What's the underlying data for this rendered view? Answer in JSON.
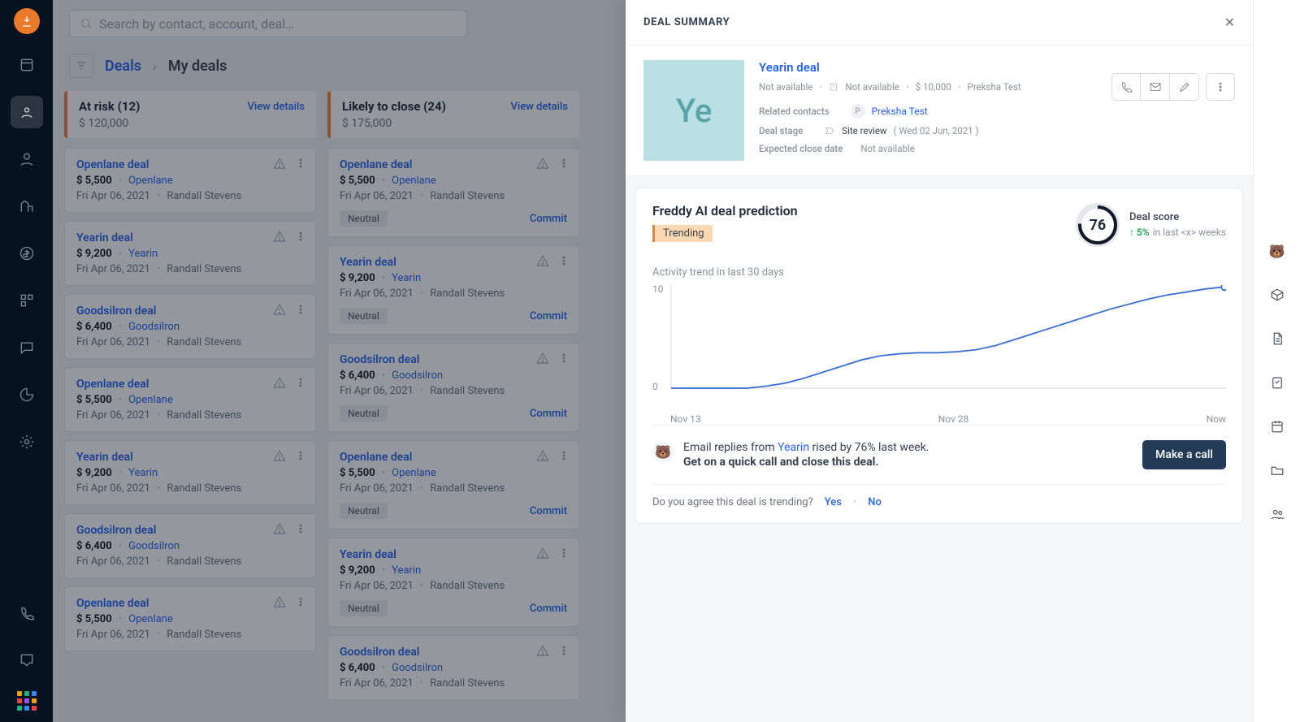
{
  "search": {
    "placeholder": "Search by contact, account, deal…"
  },
  "breadcrumb": {
    "root": "Deals",
    "current": "My deals"
  },
  "columns": [
    {
      "title": "At risk (12)",
      "amount": "$ 120,000",
      "view": "View details",
      "cards": [
        {
          "name": "Openlane deal",
          "amount": "$ 5,500",
          "account": "Openlane",
          "date": "Fri Apr 06, 2021",
          "owner": "Randall Stevens"
        },
        {
          "name": "Yearin deal",
          "amount": "$ 9,200",
          "account": "Yearin",
          "date": "Fri Apr 06, 2021",
          "owner": "Randall Stevens"
        },
        {
          "name": "Goodsilron deal",
          "amount": "$ 6,400",
          "account": "Goodsilron",
          "date": "Fri Apr 06, 2021",
          "owner": "Randall Stevens"
        },
        {
          "name": "Openlane deal",
          "amount": "$ 5,500",
          "account": "Openlane",
          "date": "Fri Apr 06, 2021",
          "owner": "Randall Stevens"
        },
        {
          "name": "Yearin deal",
          "amount": "$ 9,200",
          "account": "Yearin",
          "date": "Fri Apr 06, 2021",
          "owner": "Randall Stevens"
        },
        {
          "name": "Goodsilron deal",
          "amount": "$ 6,400",
          "account": "Goodsilron",
          "date": "Fri Apr 06, 2021",
          "owner": "Randall Stevens"
        },
        {
          "name": "Openlane deal",
          "amount": "$ 5,500",
          "account": "Openlane",
          "date": "Fri Apr 06, 2021",
          "owner": "Randall Stevens"
        }
      ]
    },
    {
      "title": "Likely to close (24)",
      "amount": "$ 175,000",
      "view": "View details",
      "cards": [
        {
          "name": "Openlane deal",
          "amount": "$ 5,500",
          "account": "Openlane",
          "date": "Fri Apr 06, 2021",
          "owner": "Randall Stevens",
          "tag": "Neutral",
          "commit": "Commit"
        },
        {
          "name": "Yearin deal",
          "amount": "$ 9,200",
          "account": "Yearin",
          "date": "Fri Apr 06, 2021",
          "owner": "Randall Stevens",
          "tag": "Neutral",
          "commit": "Commit"
        },
        {
          "name": "Goodsilron deal",
          "amount": "$ 6,400",
          "account": "Goodsilron",
          "date": "Fri Apr 06, 2021",
          "owner": "Randall Stevens",
          "tag": "Neutral",
          "commit": "Commit"
        },
        {
          "name": "Openlane deal",
          "amount": "$ 5,500",
          "account": "Openlane",
          "date": "Fri Apr 06, 2021",
          "owner": "Randall Stevens",
          "tag": "Neutral",
          "commit": "Commit"
        },
        {
          "name": "Yearin deal",
          "amount": "$ 9,200",
          "account": "Yearin",
          "date": "Fri Apr 06, 2021",
          "owner": "Randall Stevens",
          "tag": "Neutral",
          "commit": "Commit"
        },
        {
          "name": "Goodsilron deal",
          "amount": "$ 6,400",
          "account": "Goodsilron",
          "date": "Fri Apr 06, 2021",
          "owner": "Randall Stevens"
        }
      ]
    }
  ],
  "panel": {
    "heading": "DEAL SUMMARY",
    "deal_name": "Yearin deal",
    "thumb_initials": "Ye",
    "meta": {
      "phone": "Not available",
      "email": "Not available",
      "value": "$ 10,000",
      "owner": "Preksha Test"
    },
    "related_contacts_label": "Related contacts",
    "related_contact_initial": "P",
    "related_contact_name": "Preksha Test",
    "stage_label": "Deal stage",
    "stage_value": "Site review",
    "stage_date": "( Wed 02 Jun, 2021 )",
    "close_label": "Expected close date",
    "close_value": "Not available",
    "prediction": {
      "title": "Freddy AI deal prediction",
      "trend_tag": "Trending",
      "score_label": "Deal score",
      "score": "76",
      "delta": "5%",
      "delta_suffix": "in last <x> weeks",
      "chart_title": "Activity trend in last 30 days",
      "insight_prefix": "Email replies from ",
      "insight_link": "Yearin",
      "insight_suffix": " rised by 76% last week.",
      "insight_bold": "Get on a quick call and close this deal.",
      "cta": "Make a call",
      "agree_q": "Do you agree this deal is trending?",
      "agree_yes": "Yes",
      "agree_no": "No"
    }
  },
  "chart_data": {
    "type": "line",
    "title": "Activity trend in last 30 days",
    "ylim": [
      0,
      10
    ],
    "y_ticks": [
      0,
      10
    ],
    "x_ticks": [
      "Nov 13",
      "Nov 28",
      "Now"
    ],
    "x": [
      0,
      1,
      2,
      3,
      4,
      5,
      6,
      7,
      8,
      9,
      10,
      11,
      12,
      13,
      14,
      15,
      16,
      17,
      18,
      19,
      20,
      21,
      22,
      23,
      24,
      25,
      26,
      27,
      28,
      29
    ],
    "values": [
      0,
      0,
      0,
      0,
      0,
      0.2,
      0.5,
      1.0,
      1.6,
      2.2,
      2.8,
      3.2,
      3.4,
      3.5,
      3.5,
      3.6,
      3.8,
      4.2,
      4.8,
      5.4,
      6.0,
      6.6,
      7.2,
      7.8,
      8.3,
      8.8,
      9.2,
      9.5,
      9.8,
      10.0
    ]
  }
}
